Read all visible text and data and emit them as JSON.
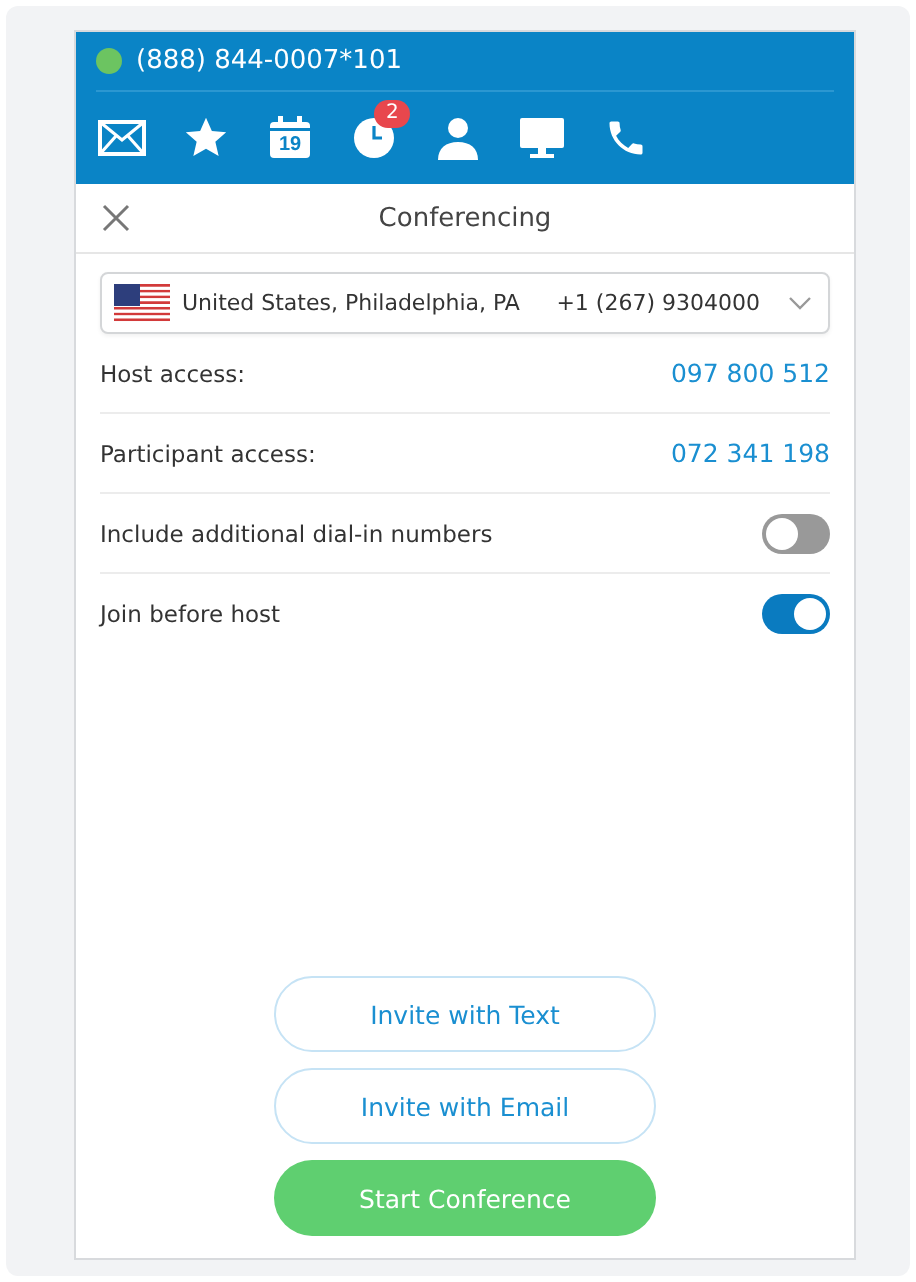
{
  "header": {
    "phone_number": "(888) 844-0007*101",
    "calendar_day": "19",
    "history_badge": "2"
  },
  "title_bar": {
    "title": "Conferencing"
  },
  "dial_in": {
    "location": "United States, Philadelphia, PA",
    "number": "+1 (267) 9304000"
  },
  "access": [
    {
      "label": "Host access:",
      "code": "097 800 512"
    },
    {
      "label": "Participant access:",
      "code": "072 341 198"
    }
  ],
  "options": [
    {
      "label": "Include additional dial-in numbers",
      "on": false
    },
    {
      "label": "Join before host",
      "on": true
    }
  ],
  "buttons": [
    {
      "label": "Invite with Text",
      "kind": "outline"
    },
    {
      "label": "Invite with Email",
      "kind": "outline"
    },
    {
      "label": "Start Conference",
      "kind": "primary"
    }
  ]
}
